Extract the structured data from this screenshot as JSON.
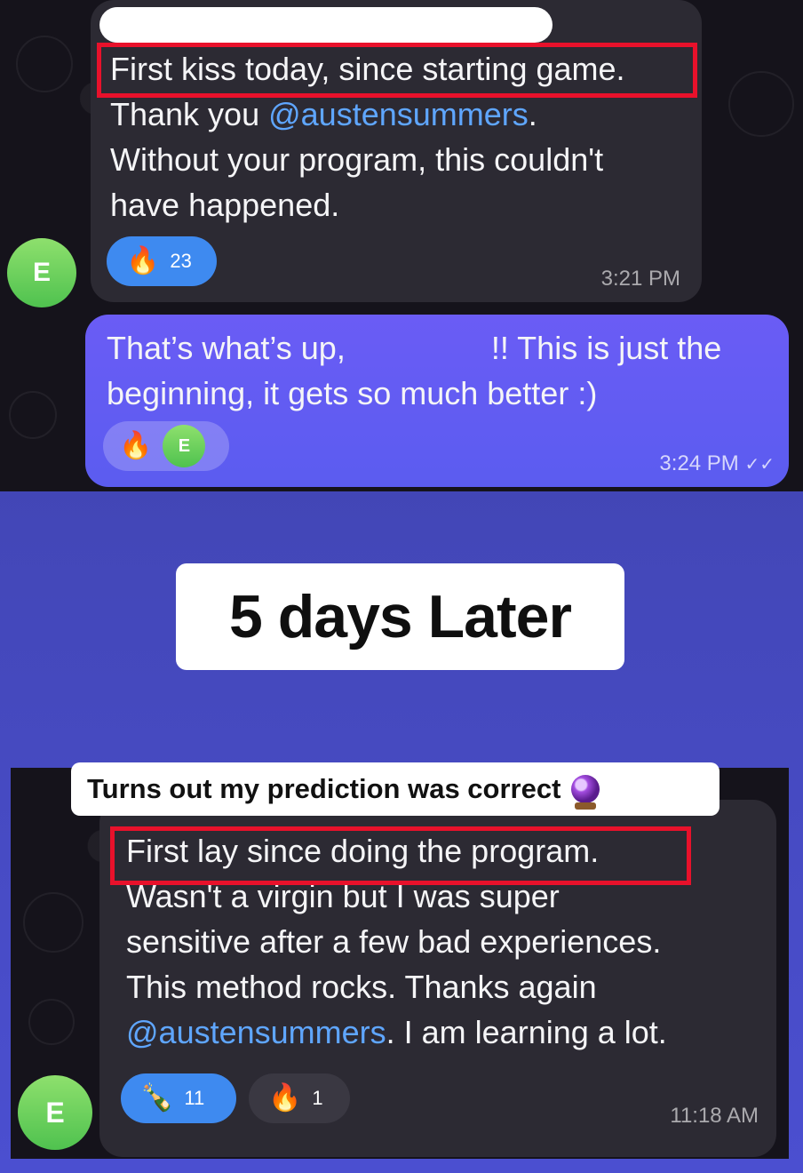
{
  "chat1": {
    "incoming": {
      "lines": [
        "First kiss today, since starting game.",
        "Thank you ",
        "Without your program, this couldn't",
        "have happened."
      ],
      "mention": "@austensummers",
      "mention_suffix": ".",
      "reaction": {
        "emoji": "🔥",
        "count": "23"
      },
      "time": "3:21 PM",
      "avatar_letter": "E"
    },
    "outgoing": {
      "line1_start": "That’s what’s up,",
      "line1_end": "!! This is just the",
      "line2": "beginning, it gets so much better :)",
      "reaction_emoji": "🔥",
      "reaction_avatar_letter": "E",
      "time": "3:24 PM",
      "read_icon": "✓✓"
    }
  },
  "divider": {
    "text": "5 days Later"
  },
  "caption": {
    "text": "Turns out my prediction was correct",
    "icon": "crystal-ball-icon"
  },
  "chat2": {
    "incoming": {
      "line1": "First lay since doing the program.",
      "line2": "Wasn't a virgin but I was super",
      "line3": "sensitive after a few bad experiences.",
      "line4": "This method rocks. Thanks again",
      "mention": "@austensummers",
      "line5_suffix": ". I am learning a lot.",
      "reactions": [
        {
          "emoji": "🍾",
          "count": "11"
        },
        {
          "emoji": "🔥",
          "count": "1"
        }
      ],
      "time": "11:18 AM",
      "avatar_letter": "E"
    }
  },
  "colors": {
    "highlight": "#e8112b",
    "mention": "#5fa6ff",
    "outgoing_bubble": "#6a5cf5",
    "incoming_bubble": "#2c2a33",
    "reaction_blue": "#3e8af0",
    "avatar_green": "#4fc24f"
  }
}
